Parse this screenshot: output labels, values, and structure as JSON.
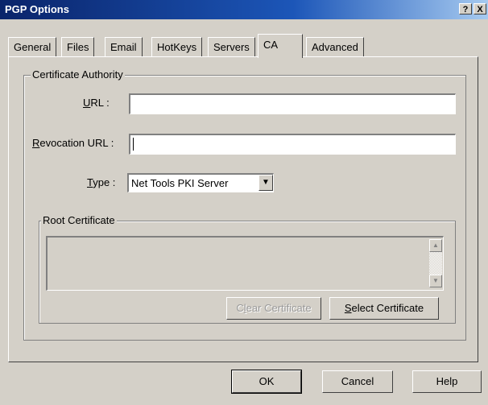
{
  "window": {
    "title": "PGP Options",
    "help_btn": "?",
    "close_btn": "X"
  },
  "tabs": [
    {
      "label": "General",
      "active": false
    },
    {
      "label": "Files",
      "active": false
    },
    {
      "label": "Email",
      "active": false
    },
    {
      "label": "HotKeys",
      "active": false
    },
    {
      "label": "Servers",
      "active": false
    },
    {
      "label": "CA",
      "active": true
    },
    {
      "label": "Advanced",
      "active": false
    }
  ],
  "ca_group": {
    "legend": "Certificate Authority",
    "url_label_hotkey": "U",
    "url_label_rest": "RL :",
    "url_value": "",
    "revocation_label_hotkey": "R",
    "revocation_label_rest": "evocation URL :",
    "revocation_value": "",
    "type_label_hotkey": "T",
    "type_label_rest": "ype :",
    "type_value": "Net Tools PKI Server"
  },
  "root_group": {
    "legend": "Root Certificate",
    "content": "",
    "scroll_up": "▲",
    "scroll_down": "▼",
    "clear_button_hotkey": "l",
    "clear_button_pre": "C",
    "clear_button_post": "ear Certificate",
    "select_button_hotkey": "S",
    "select_button_rest": "elect Certificate"
  },
  "footer": {
    "ok": "OK",
    "cancel": "Cancel",
    "help": "Help"
  }
}
